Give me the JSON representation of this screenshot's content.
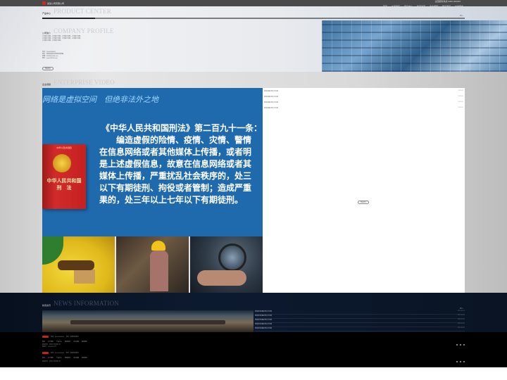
{
  "header": {
    "logo_text": "某某公司有限公司",
    "contact": "全国服务热线 0000-000000",
    "nav": [
      "首页",
      "关于我们",
      "产品中心",
      "新闻资讯",
      "企业视频",
      "联系我们",
      "在线留言"
    ]
  },
  "product_center": {
    "title_cn": "产品中心",
    "title_en": "PRODUCT CENTER",
    "more": "更多+"
  },
  "company_profile": {
    "title_cn": "公司简介",
    "title_en": "COMPANY PROFILE",
    "body": "公司简介内容，公司简介内容，公司简介内容，公司简介内容，公司简介内容，公司简介内容，公司简介内容，公司简介内容，公司简介内容，公司简介内容。",
    "contact_lines": [
      "电话：000-00000000",
      "地址：某某省某某市某某区某某路",
      "邮箱：000000@000.com",
      "网址：www.000000.com"
    ],
    "button": "查看更多"
  },
  "enterprise_video": {
    "title_cn": "企业视频",
    "title_en": "ENTERPRISE VIDEO",
    "slogan": "网络是虚拟空间　但绝非法外之地",
    "law_heading": "《中华人民共和国刑法》第二百九十一条：",
    "law_text": "　　编造虚假的险情、疫情、灾情、警情\n在信息网络或者其他媒体上传播，或者明\n是上述虚假信息，故意在信息网络或者其\n媒体上传播，严重扰乱社会秩序的，处三\n以下有期徒刑、拘役或者管制；造成严重\n果的，处三年以上七年以下有期徒刑。",
    "book_top": "中华人民共和国",
    "book_title": "中华人民共和国\n刑　法",
    "panel_items": [
      {
        "text": "新闻标题示例文字内容",
        "date": "2021-01"
      },
      {
        "text": "新闻标题示例文字内容",
        "date": "2021-01"
      },
      {
        "text": "新闻标题示例文字内容",
        "date": "2021-01"
      },
      {
        "text": "新闻标题示例文字内容",
        "date": "2021-01"
      }
    ],
    "button": "查看更多"
  },
  "news": {
    "title_cn": "新闻资讯",
    "title_en": "NEWS INFORMATION",
    "more": "更多+",
    "items": [
      {
        "text": "新闻资讯标题示例文字内容",
        "date": "2021-01-01"
      },
      {
        "text": "新闻资讯标题示例文字内容",
        "date": "2021-01-01"
      },
      {
        "text": "新闻资讯标题示例文字内容",
        "date": "2021-01-01"
      },
      {
        "text": "新闻资讯标题示例文字内容",
        "date": "2021-01-01"
      },
      {
        "text": "新闻资讯标题示例文字内容",
        "date": "2021-01-01"
      }
    ]
  },
  "footer": {
    "row1": [
      "电话：000-00000000",
      "地址：某某省某某市"
    ],
    "nav": [
      "首页",
      "关于我们",
      "产品中心",
      "新闻资讯",
      "企业视频",
      "联系我们"
    ],
    "info": [
      "版权所有：某某公司有限公司",
      "备案号：000000000号"
    ],
    "row2": [
      "电话：000-00000000",
      "地址：某某省某某市"
    ],
    "nav2": [
      "首页",
      "关于我们",
      "产品中心",
      "新闻资讯",
      "企业视频",
      "联系我们"
    ],
    "info2": [
      "版权所有：某某公司有限公司"
    ]
  },
  "colors": {
    "brand_red": "#d7261e",
    "video_blue": "#1f6aad",
    "dark_band": "#0c1a30"
  }
}
